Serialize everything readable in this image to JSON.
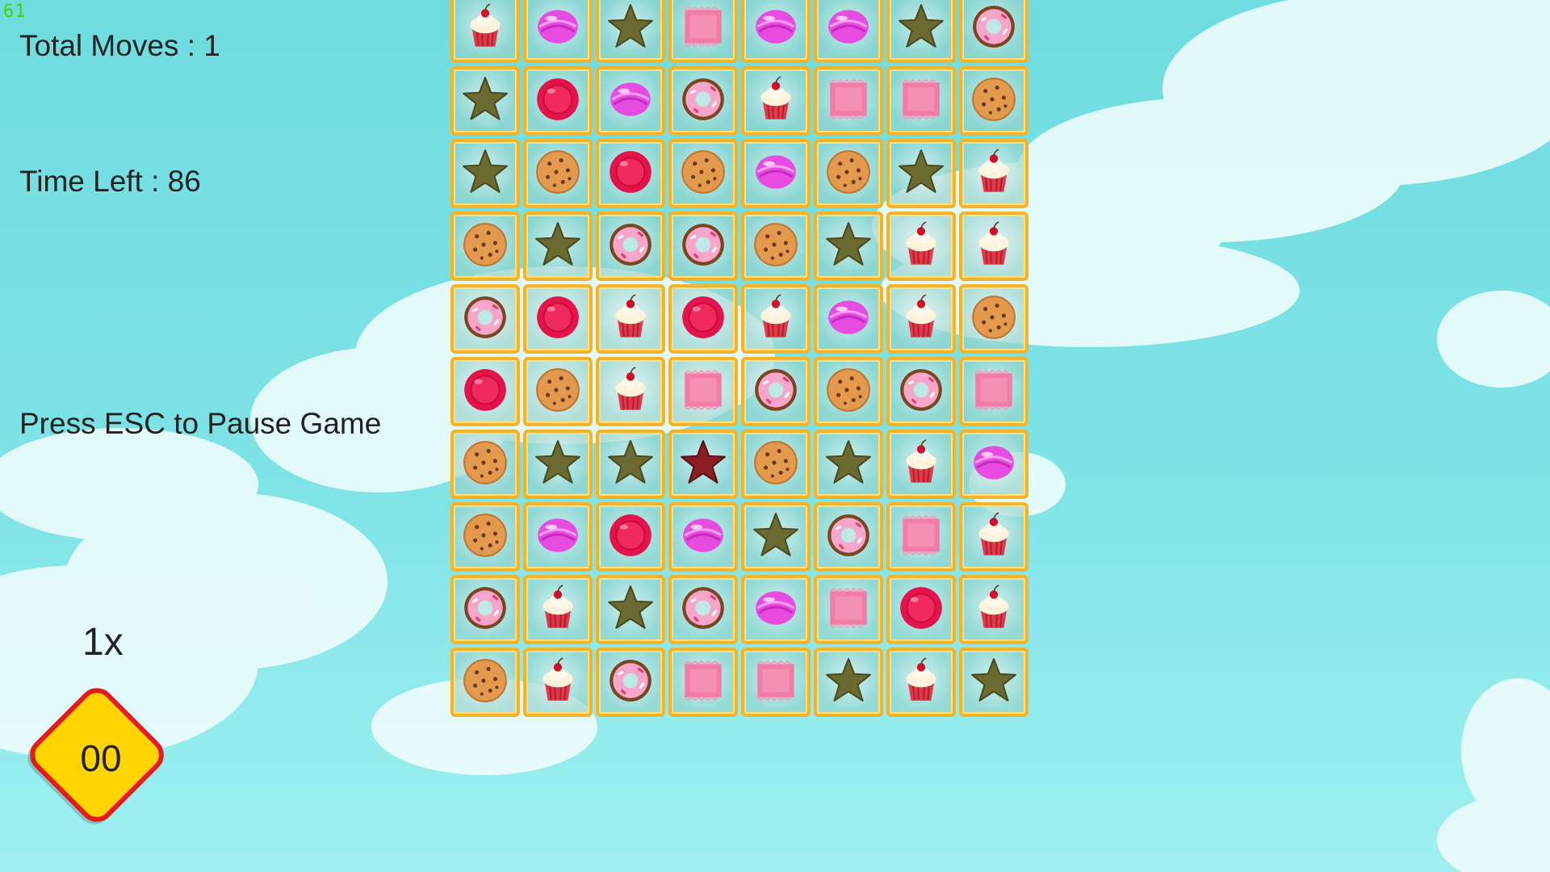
{
  "fps": "61",
  "hud": {
    "total_moves": "Total Moves : 1",
    "time_left": "Time Left : 86",
    "pause_hint": "Press ESC to Pause Game",
    "multiplier": "1x",
    "combo": "00"
  },
  "colors": {
    "tile_border": "#f3b32a",
    "badge_fill": "#ffd400",
    "badge_border": "#e41b1b"
  },
  "board": {
    "rows": 10,
    "cols": 8,
    "candies": [
      [
        "cupcake",
        "lollipop",
        "star",
        "wrapped",
        "lollipop",
        "lollipop",
        "star",
        "donut"
      ],
      [
        "star",
        "gumdrop",
        "lollipop",
        "donut",
        "cupcake",
        "wrapped",
        "wrapped",
        "cookie"
      ],
      [
        "star",
        "cookie",
        "gumdrop",
        "cookie",
        "lollipop",
        "cookie",
        "star",
        "cupcake"
      ],
      [
        "cookie",
        "star",
        "donut",
        "donut",
        "cookie",
        "star",
        "cupcake",
        "cupcake"
      ],
      [
        "donut",
        "gumdrop",
        "cupcake",
        "gumdrop",
        "cupcake",
        "lollipop",
        "cupcake",
        "cookie"
      ],
      [
        "gumdrop",
        "cookie",
        "cupcake",
        "wrapped",
        "donut",
        "cookie",
        "donut",
        "wrapped"
      ],
      [
        "cookie",
        "star",
        "star",
        "red-star",
        "cookie",
        "star",
        "cupcake",
        "lollipop"
      ],
      [
        "cookie",
        "lollipop",
        "gumdrop",
        "lollipop",
        "star",
        "donut",
        "wrapped",
        "cupcake"
      ],
      [
        "donut",
        "cupcake",
        "star",
        "donut",
        "lollipop",
        "wrapped",
        "gumdrop",
        "cupcake"
      ],
      [
        "cookie",
        "cupcake",
        "donut",
        "wrapped",
        "wrapped",
        "star",
        "cupcake",
        "star"
      ]
    ]
  }
}
